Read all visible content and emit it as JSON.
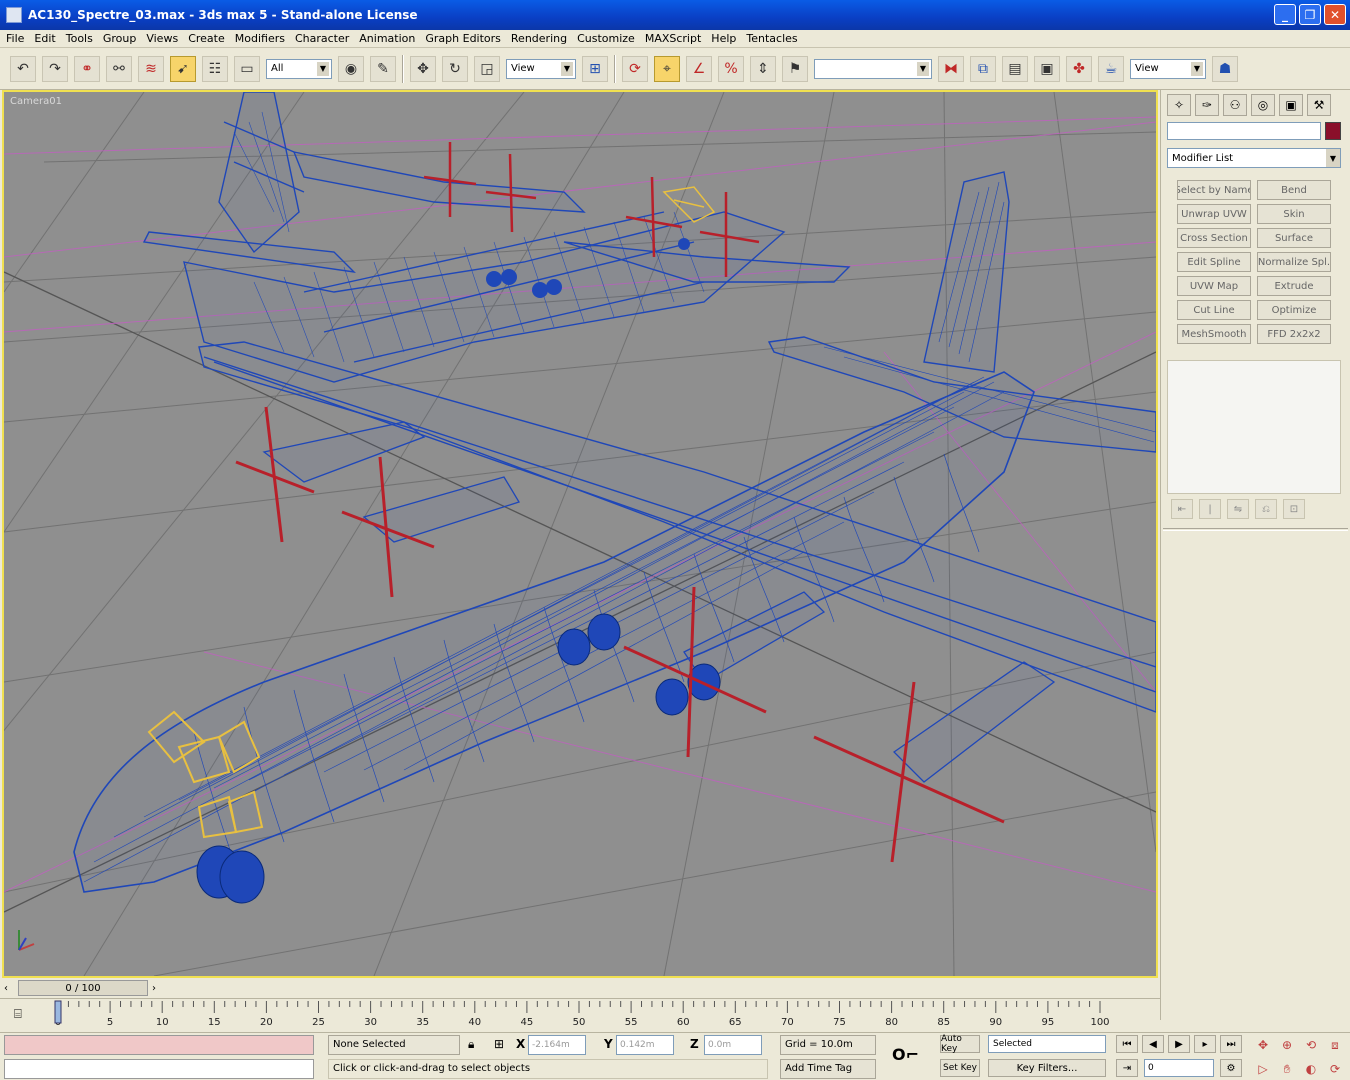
{
  "window": {
    "title": "AC130_Spectre_03.max - 3ds max 5 - Stand-alone License",
    "min": "_",
    "restore": "❐",
    "close": "✕"
  },
  "menu": [
    "File",
    "Edit",
    "Tools",
    "Group",
    "Views",
    "Create",
    "Modifiers",
    "Character",
    "Animation",
    "Graph Editors",
    "Rendering",
    "Customize",
    "MAXScript",
    "Help",
    "Tentacles"
  ],
  "toolbar": {
    "selection_filter": "All",
    "ref_coord": "View",
    "named_sel": "",
    "render_type": "View"
  },
  "viewport": {
    "label": "Camera01"
  },
  "command_panel": {
    "tabs": [
      "create",
      "modify",
      "hierarchy",
      "motion",
      "display",
      "utilities"
    ],
    "modifier_list": "Modifier List",
    "modifiers": [
      "Select by Name",
      "Bend",
      "Unwrap UVW",
      "Skin",
      "Cross Section",
      "Surface",
      "Edit Spline",
      "Normalize Spl.",
      "UVW Map",
      "Extrude",
      "Cut Line",
      "Optimize",
      "MeshSmooth",
      "FFD 2x2x2"
    ],
    "stack_tools": [
      "⇤",
      "|",
      "⇋",
      "⎌",
      "⊡"
    ]
  },
  "timeline": {
    "slider": "0 / 100",
    "ticks": [
      "0",
      "5",
      "10",
      "15",
      "20",
      "25",
      "30",
      "35",
      "40",
      "45",
      "50",
      "55",
      "60",
      "65",
      "70",
      "75",
      "80",
      "85",
      "90",
      "95",
      "100"
    ]
  },
  "status": {
    "selection": "None Selected",
    "prompt": "Click or click-and-drag to select objects",
    "x_label": "X",
    "y_label": "Y",
    "z_label": "Z",
    "x_value": "-2.164m",
    "y_value": "0.142m",
    "z_value": "0.0m",
    "grid": "Grid = 10.0m",
    "add_time_tag": "Add Time Tag",
    "auto_key": "Auto Key",
    "set_key": "Set Key",
    "key_mode": "Selected",
    "key_filters": "Key Filters...",
    "frame": "0"
  },
  "colors": {
    "wire_blue": "#1f47b8",
    "prop_red": "#b8202a",
    "cockpit_yellow": "#e8c040",
    "grid_line": "#707070",
    "viewport_bg": "#8f8f8f",
    "active_border": "#f0e050",
    "guide_magenta": "#c060c0"
  }
}
